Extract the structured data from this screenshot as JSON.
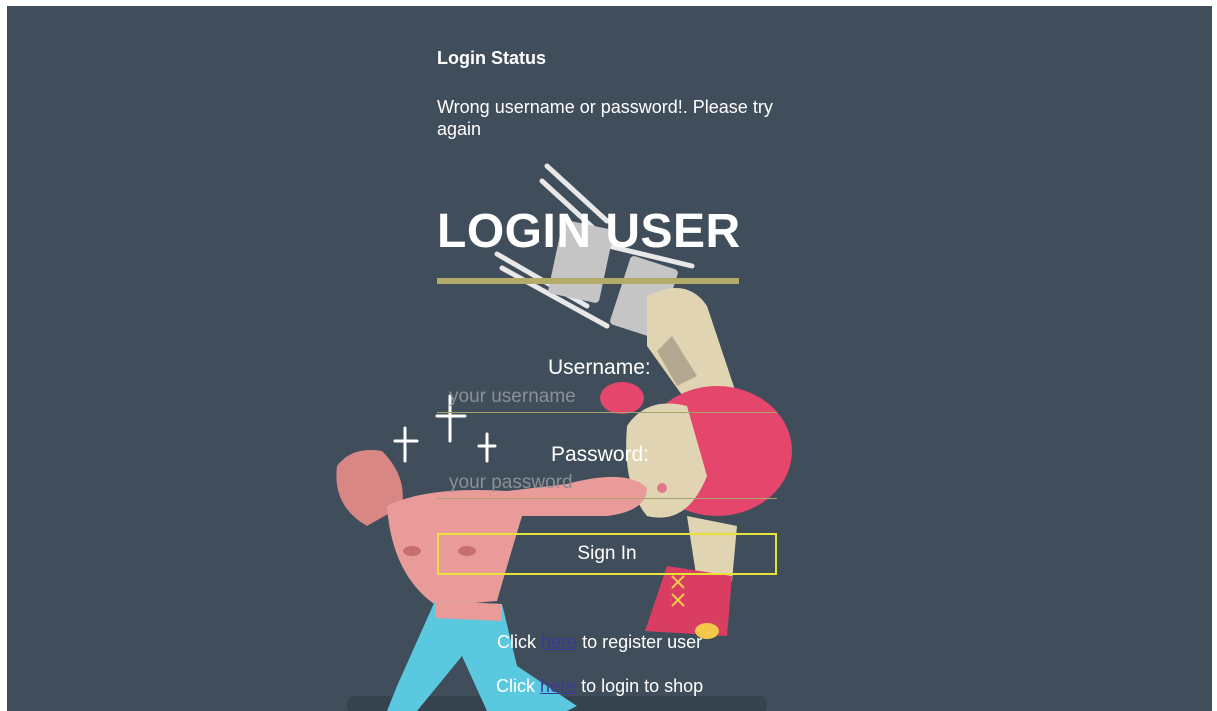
{
  "status": {
    "title": "Login Status",
    "message": "Wrong username or password!. Please try again"
  },
  "login": {
    "title": "LOGIN USER",
    "username_label": "Username:",
    "username_placeholder": "your username",
    "password_label": "Password:",
    "password_placeholder": "your password",
    "submit_label": "Sign In"
  },
  "links": {
    "register_prefix": "Click",
    "register_link": "here",
    "register_suffix": "to register user",
    "shop_prefix": "Click",
    "shop_link": "here",
    "shop_suffix": "to login to shop"
  },
  "colors": {
    "background": "#404e5b",
    "underline": "#b3ab6a",
    "button_border": "#e6e23a",
    "link": "#3a3a9a"
  }
}
